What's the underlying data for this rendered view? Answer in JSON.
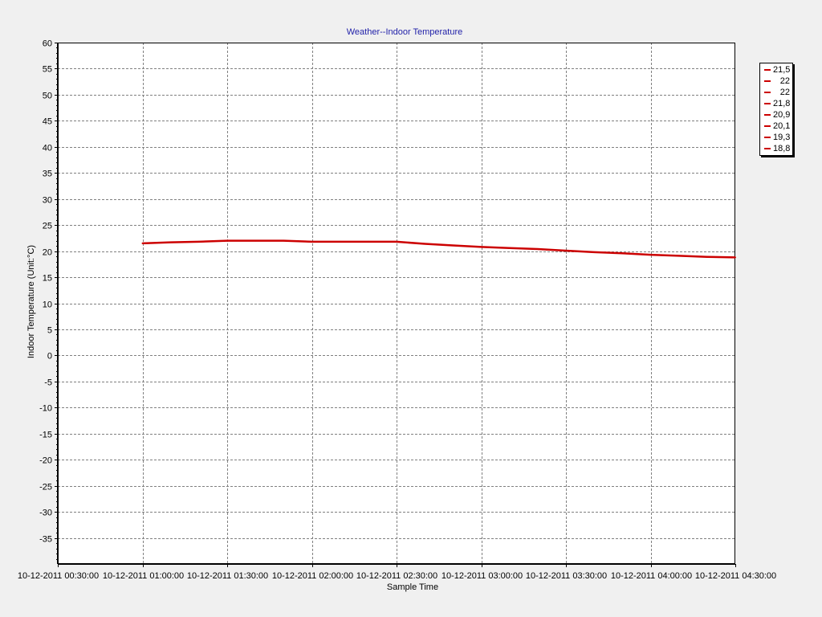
{
  "chart_data": {
    "type": "line",
    "title": "Weather--Indoor Temperature",
    "xlabel": "Sample Time",
    "ylabel": "Indoor Temperature (Unit:°C)",
    "ylim": [
      -40,
      60
    ],
    "yticks": [
      60,
      55,
      50,
      45,
      40,
      35,
      30,
      25,
      20,
      15,
      10,
      5,
      0,
      -5,
      -10,
      -15,
      -20,
      -25,
      -30,
      -35
    ],
    "xlim": [
      "10-12-2011 00:30:00",
      "10-12-2011 04:30:00"
    ],
    "xticks": [
      "10-12-2011 00:30:00",
      "10-12-2011 01:00:00",
      "10-12-2011 01:30:00",
      "10-12-2011 02:00:00",
      "10-12-2011 02:30:00",
      "10-12-2011 03:00:00",
      "10-12-2011 03:30:00",
      "10-12-2011 04:00:00",
      "10-12-2011 04:30:00"
    ],
    "grid": true,
    "legend_position": "right",
    "series": [
      {
        "color": "#cc0000",
        "x": [
          "10-12-2011 01:00:00",
          "10-12-2011 01:10:00",
          "10-12-2011 01:20:00",
          "10-12-2011 01:30:00",
          "10-12-2011 01:40:00",
          "10-12-2011 01:50:00",
          "10-12-2011 02:00:00",
          "10-12-2011 02:10:00",
          "10-12-2011 02:20:00",
          "10-12-2011 02:30:00",
          "10-12-2011 02:40:00",
          "10-12-2011 02:50:00",
          "10-12-2011 03:00:00",
          "10-12-2011 03:10:00",
          "10-12-2011 03:20:00",
          "10-12-2011 03:30:00",
          "10-12-2011 03:40:00",
          "10-12-2011 03:50:00",
          "10-12-2011 04:00:00",
          "10-12-2011 04:10:00",
          "10-12-2011 04:20:00",
          "10-12-2011 04:30:00"
        ],
        "y": [
          21.5,
          21.7,
          21.8,
          22.0,
          22.0,
          22.0,
          21.8,
          21.8,
          21.8,
          21.8,
          21.4,
          21.1,
          20.8,
          20.6,
          20.4,
          20.1,
          19.8,
          19.6,
          19.3,
          19.1,
          18.9,
          18.8
        ]
      }
    ],
    "legend": [
      {
        "label": "21,5",
        "color": "#cc0000"
      },
      {
        "label": "22",
        "color": "#cc0000"
      },
      {
        "label": "22",
        "color": "#cc0000"
      },
      {
        "label": "21,8",
        "color": "#cc0000"
      },
      {
        "label": "20,9",
        "color": "#cc0000"
      },
      {
        "label": "20,1",
        "color": "#cc0000"
      },
      {
        "label": "19,3",
        "color": "#cc0000"
      },
      {
        "label": "18,8",
        "color": "#cc0000"
      }
    ]
  },
  "colors": {
    "background": "#f0f0f0",
    "plot_background": "#ffffff",
    "title": "#1f1fa8",
    "grid": "#808080",
    "axis": "#000000",
    "series": "#cc0000"
  }
}
